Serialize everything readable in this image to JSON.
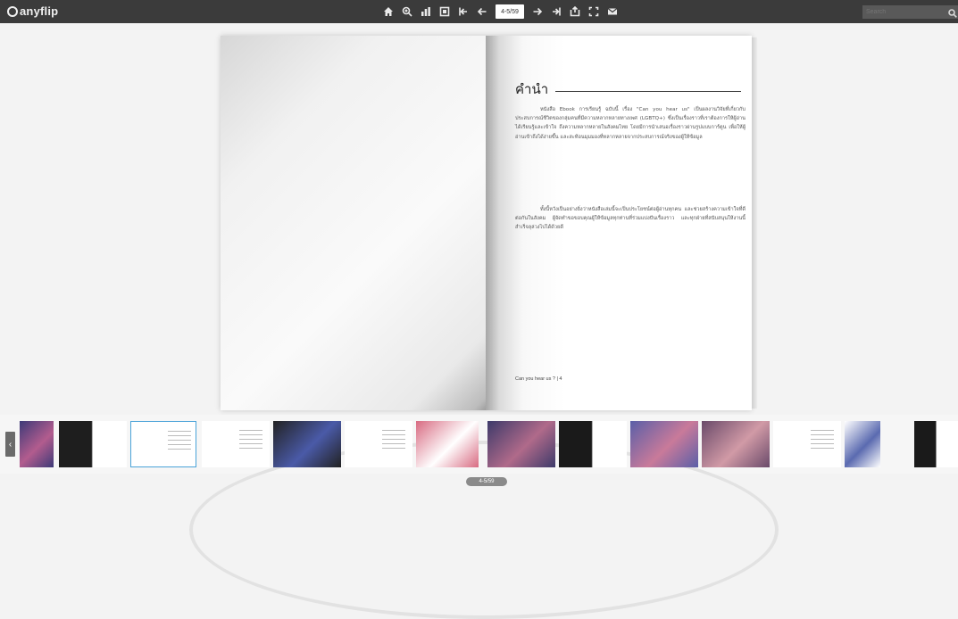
{
  "toolbar": {
    "brand": "anyflip",
    "page_indicator": "4-5/59",
    "search_placeholder": "Search",
    "tools": [
      "home-icon",
      "zoom-icon",
      "grid-icon",
      "single-page-icon",
      "first-page-icon",
      "prev-page-icon",
      "next-page-icon",
      "last-page-icon",
      "share-icon",
      "fullscreen-icon",
      "email-icon"
    ]
  },
  "book": {
    "right_page": {
      "heading": "คำนำ",
      "paragraph_1": "หนังสือ Ebook การเรียนรู้ ฉบับนี้ เรื่อง \"Can you hear us\" เป็นผลงานวิจัยที่เกี่ยวกับประสบการณ์ชีวิตของกลุ่มคนที่มีความหลากหลายทางเพศ (LGBTQ+) ซึ่งเป็นเรื่องราวที่เราต้องการให้ผู้อ่านได้เรียนรู้และเข้าใจ ถึงความหลากหลายในสังคมไทย โดยมีการนำเสนอเรื่องราวผ่านรูปแบบการ์ตูน เพื่อให้ผู้อ่านเข้าถึงได้ง่ายขึ้น และสะท้อนมุมมองที่หลากหลายจากประสบการณ์จริงของผู้ให้ข้อมูล",
      "paragraph_2": "ทั้งนี้หวังเป็นอย่างยิ่งว่าหนังสือเล่มนี้จะเป็นประโยชน์ต่อผู้อ่านทุกคน และช่วยสร้างความเข้าใจที่ดีต่อกันในสังคม ผู้จัดทำขอขอบคุณผู้ให้ข้อมูลทุกท่านที่ร่วมแบ่งปันเรื่องราว และทุกฝ่ายที่สนับสนุนให้งานนี้สำเร็จลุล่วงไปได้ด้วยดี",
      "footer": "Can you hear us ? | 4"
    }
  },
  "thumbnails": {
    "current_index": 1,
    "pager": "4-5/59",
    "items": [
      {
        "kind": "cover",
        "colors": [
          "#3d3a78",
          "#b25c8e"
        ]
      },
      {
        "kind": "dark-script",
        "colors": [
          "#1e1e1e",
          "#ffffff"
        ]
      },
      {
        "kind": "text",
        "colors": [
          "#ffffff",
          "#ffffff"
        ]
      },
      {
        "kind": "text",
        "colors": [
          "#ffffff",
          "#ffffff"
        ]
      },
      {
        "kind": "illustration",
        "colors": [
          "#222222",
          "#4a5aa8"
        ]
      },
      {
        "kind": "text",
        "colors": [
          "#ffffff",
          "#ffffff"
        ]
      },
      {
        "kind": "illustration",
        "colors": [
          "#d86b82",
          "#ffffff"
        ]
      },
      {
        "kind": "illustration",
        "colors": [
          "#3d3a6a",
          "#b06a8a"
        ]
      },
      {
        "kind": "dark-text",
        "colors": [
          "#1a1a1a",
          "#ffffff"
        ]
      },
      {
        "kind": "illustration",
        "colors": [
          "#5a5fa8",
          "#c97a9a"
        ]
      },
      {
        "kind": "illustration",
        "colors": [
          "#6a4a6a",
          "#d19aa6"
        ]
      },
      {
        "kind": "text",
        "colors": [
          "#ffffff",
          "#ffffff"
        ]
      },
      {
        "kind": "illustration",
        "colors": [
          "#ffffff",
          "#5a6ab0"
        ]
      },
      {
        "kind": "dark-text",
        "colors": [
          "#1a1a1a",
          "#ffffff"
        ]
      }
    ]
  },
  "colors": {
    "toolbar_bg": "#3b3b3b",
    "page_bg": "#f3f3f3",
    "active_thumb_border": "#4aa3d8"
  }
}
